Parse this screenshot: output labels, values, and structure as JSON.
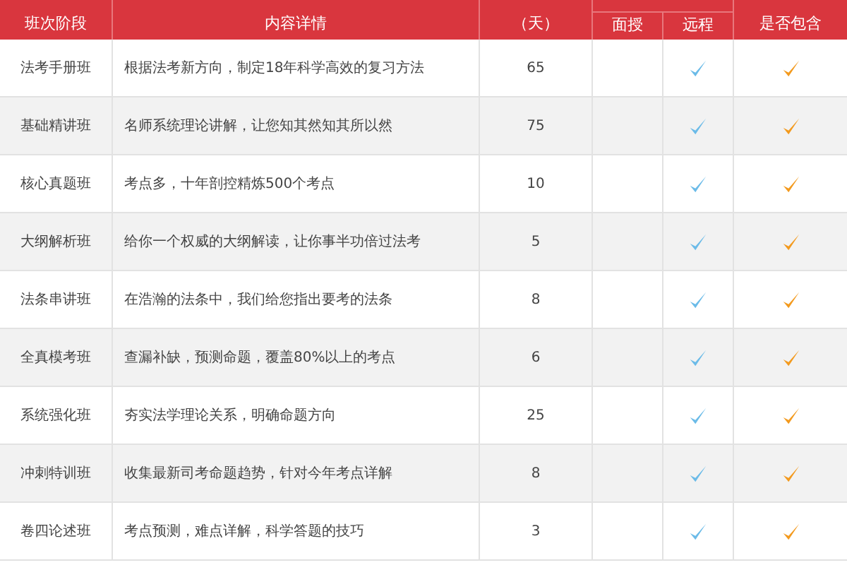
{
  "table": {
    "columns": [
      {
        "label": "班次阶段"
      },
      {
        "label": "内容详情"
      },
      {
        "label": "（天）"
      },
      {
        "label": "面授"
      },
      {
        "label": "远程"
      },
      {
        "label": "是否包含"
      }
    ],
    "rows": [
      {
        "stage": "法考手册班",
        "detail": "根据法考新方向，制定18年科学高效的复习方法",
        "days": "65",
        "remote": true,
        "included": true
      },
      {
        "stage": "基础精讲班",
        "detail": "名师系统理论讲解，让您知其然知其所以然",
        "days": "75",
        "remote": true,
        "included": true
      },
      {
        "stage": "核心真题班",
        "detail": "考点多，十年剖控精炼500个考点",
        "days": "10",
        "remote": true,
        "included": true
      },
      {
        "stage": "大纲解析班",
        "detail": "给你一个权威的大纲解读，让你事半功倍过法考",
        "days": "5",
        "remote": true,
        "included": true
      },
      {
        "stage": "法条串讲班",
        "detail": "在浩瀚的法条中，我们给您指出要考的法条",
        "days": "8",
        "remote": true,
        "included": true
      },
      {
        "stage": "全真模考班",
        "detail": "查漏补缺，预测命题，覆盖80%以上的考点",
        "days": "6",
        "remote": true,
        "included": true
      },
      {
        "stage": "系统强化班",
        "detail": "夯实法学理论关系，明确命题方向",
        "days": "25",
        "remote": true,
        "included": true
      },
      {
        "stage": "冲刺特训班",
        "detail": "收集最新司考命题趋势，针对今年考点详解",
        "days": "8",
        "remote": true,
        "included": true
      },
      {
        "stage": "卷四论述班",
        "detail": "考点预测，难点详解，科学答题的技巧",
        "days": "3",
        "remote": true,
        "included": true
      }
    ]
  }
}
